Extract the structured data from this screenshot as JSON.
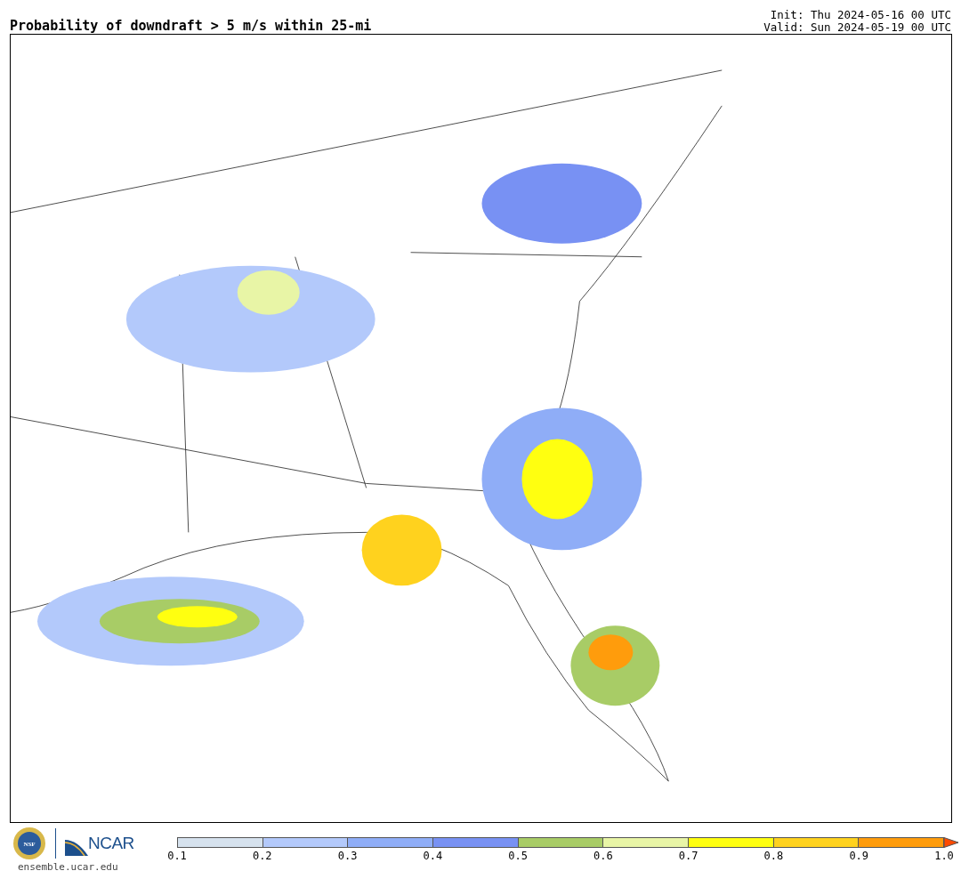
{
  "header": {
    "title": "Probability of downdraft > 5 m/s within 25-mi",
    "init": "Init: Thu 2024-05-16 00 UTC",
    "valid": "Valid: Sun 2024-05-19 00 UTC"
  },
  "footer": {
    "seal_text": "NSF",
    "logo_text": "NCAR",
    "site": "ensemble.ucar.edu"
  },
  "colorbar": {
    "segments": [
      {
        "color": "#d6e2ee"
      },
      {
        "color": "#b3c9fb"
      },
      {
        "color": "#8fadf7"
      },
      {
        "color": "#7891f3"
      },
      {
        "color": "#a8cc66"
      },
      {
        "color": "#e8f5a6"
      },
      {
        "color": "#ffff10"
      },
      {
        "color": "#ffd21e"
      },
      {
        "color": "#ff9c0c"
      }
    ],
    "extend_arrow": {
      "color": "#ff4a00"
    },
    "ticks": [
      "0.1",
      "0.2",
      "0.3",
      "0.4",
      "0.5",
      "0.6",
      "0.7",
      "0.8",
      "0.9",
      "1.0"
    ]
  }
}
